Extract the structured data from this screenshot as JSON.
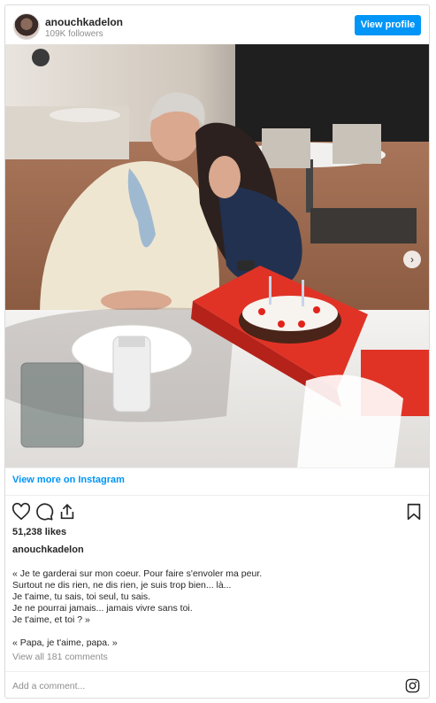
{
  "header": {
    "username": "anouchkadelon",
    "followers": "109K followers",
    "view_profile": "View profile"
  },
  "photo": {
    "next_label": "›"
  },
  "view_more": "View more on Instagram",
  "actions": {
    "icons": [
      "heart-icon",
      "comment-icon",
      "share-icon",
      "bookmark-icon"
    ]
  },
  "likes": "51,238 likes",
  "author": "anouchkadelon",
  "caption": {
    "lines": [
      "« Je te garderai sur mon coeur. Pour faire s'envoler ma peur.",
      "Surtout ne dis rien, ne dis rien, je suis trop bien... là...",
      "Je t'aime, tu sais, toi seul, tu sais.",
      "Je ne pourrai jamais... jamais vivre sans toi.",
      "Je t'aime, et toi ? »"
    ],
    "closing": "« Papa, je t'aime, papa. »"
  },
  "view_all": "View all 181 comments",
  "comment": {
    "placeholder": "Add a comment..."
  },
  "colors": {
    "accent": "#0095f6",
    "border": "#dbdbdb",
    "muted": "#8e8e8e"
  }
}
